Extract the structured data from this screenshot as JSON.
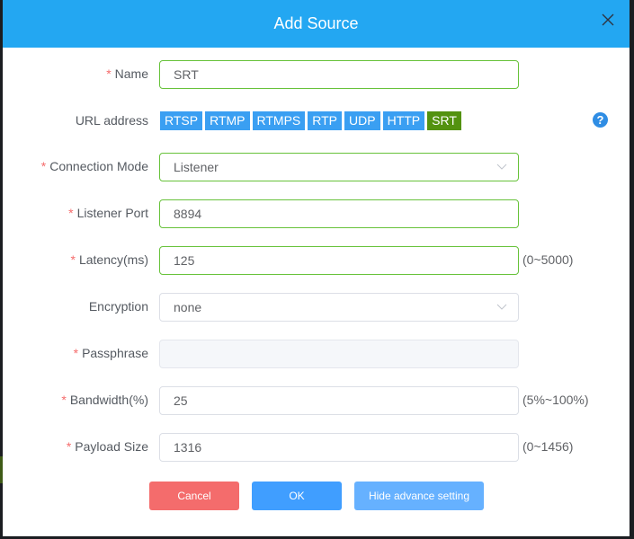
{
  "dialog": {
    "title": "Add Source",
    "close_icon": "close-icon"
  },
  "form": {
    "name": {
      "label": "Name",
      "required": "*",
      "value": "SRT"
    },
    "url_address": {
      "label": "URL address",
      "protocols": [
        "RTSP",
        "RTMP",
        "RTMPS",
        "RTP",
        "UDP",
        "HTTP",
        "SRT"
      ],
      "selected": "SRT",
      "help_icon": "?"
    },
    "connection_mode": {
      "label": "Connection Mode",
      "required": "*",
      "value": "Listener"
    },
    "listener_port": {
      "label": "Listener Port",
      "required": "*",
      "value": "8894"
    },
    "latency": {
      "label": "Latency(ms)",
      "required": "*",
      "value": "125",
      "hint": "(0~5000)"
    },
    "encryption": {
      "label": "Encryption",
      "value": "none"
    },
    "passphrase": {
      "label": "Passphrase",
      "required": "*",
      "value": ""
    },
    "bandwidth": {
      "label": "Bandwidth(%)",
      "required": "*",
      "value": "25",
      "hint": "(5%~100%)"
    },
    "payload_size": {
      "label": "Payload Size",
      "required": "*",
      "value": "1316",
      "hint": "(0~1456)"
    }
  },
  "buttons": {
    "cancel": "Cancel",
    "ok": "OK",
    "advanced": "Hide advance setting"
  },
  "colors": {
    "header": "#23a7f2",
    "protocol_tab": "#3a9ff2",
    "protocol_active": "#53920f",
    "valid_border": "#67c23a",
    "cancel": "#f46c6c",
    "ok": "#409eff",
    "advanced": "#66b1ff",
    "required_star": "#f56c6c"
  }
}
